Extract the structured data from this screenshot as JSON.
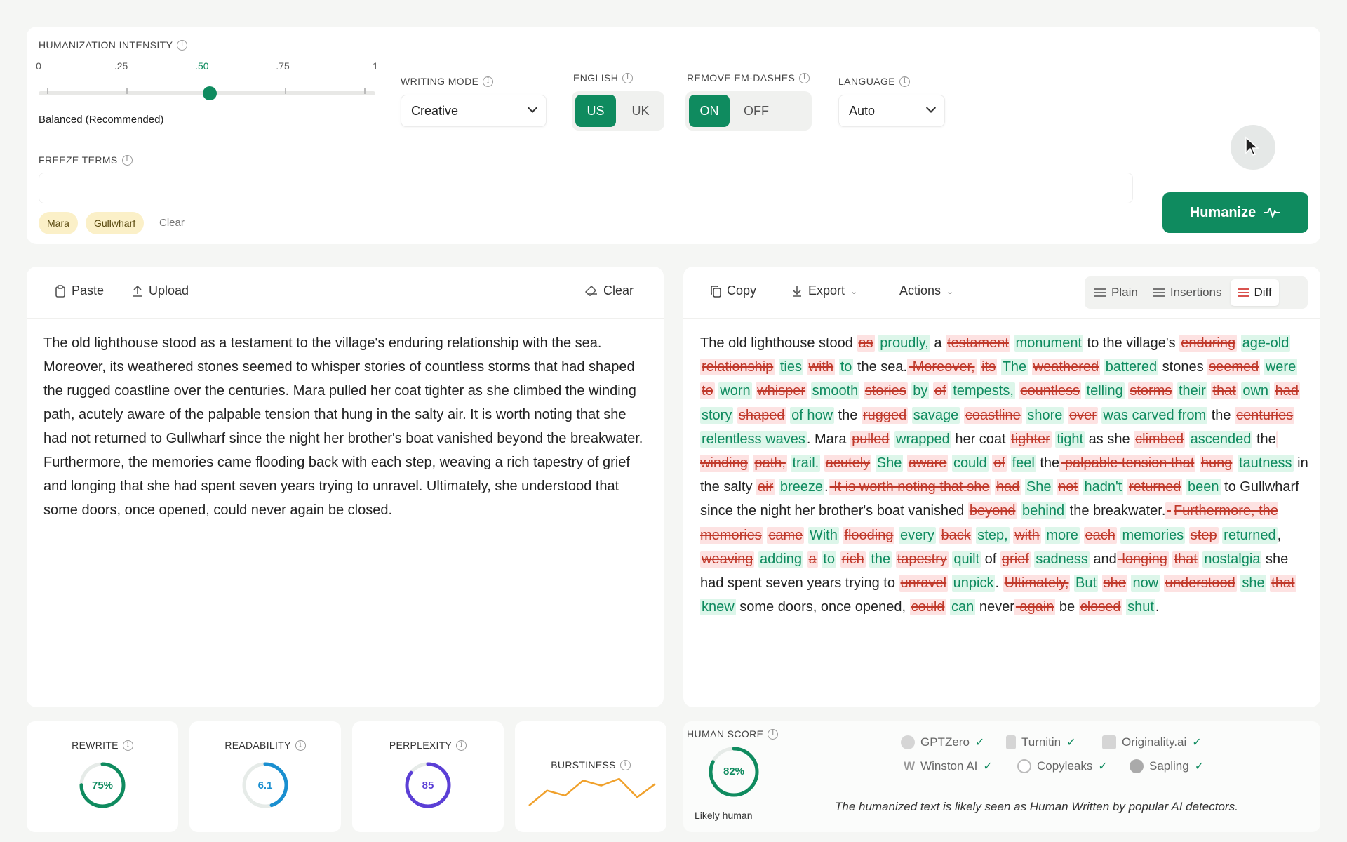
{
  "settings": {
    "intensity": {
      "label": "HUMANIZATION INTENSITY",
      "ticks": [
        "0",
        ".25",
        ".50",
        ".75",
        "1"
      ],
      "value": 0.5,
      "caption": "Balanced (Recommended)"
    },
    "writing_mode": {
      "label": "WRITING MODE",
      "value": "Creative"
    },
    "english": {
      "label": "ENGLISH",
      "options": [
        "US",
        "UK"
      ],
      "selected": "US"
    },
    "em_dashes": {
      "label": "REMOVE EM-DASHES",
      "options": [
        "ON",
        "OFF"
      ],
      "selected": "ON"
    },
    "language": {
      "label": "LANGUAGE",
      "value": "Auto"
    },
    "freeze": {
      "label": "FREEZE TERMS",
      "terms": [
        "Mara",
        "Gullwharf"
      ],
      "clear_label": "Clear"
    },
    "humanize_label": "Humanize"
  },
  "input": {
    "paste_label": "Paste",
    "upload_label": "Upload",
    "clear_label": "Clear",
    "text": "The old lighthouse stood as a testament to the village's enduring relationship with the sea. Moreover, its weathered stones seemed to whisper stories of countless storms that had shaped the rugged coastline over the centuries. Mara pulled her coat tighter as she climbed the winding path, acutely aware of the palpable tension that hung in the salty air. It is worth noting that she had not returned to Gullwharf since the night her brother's boat vanished beyond the breakwater. Furthermore, the memories came flooding back with each step, weaving a rich tapestry of grief and longing that she had spent seven years trying to unravel. Ultimately, she understood that some doors, once opened, could never again be closed."
  },
  "output": {
    "copy_label": "Copy",
    "export_label": "Export",
    "actions_label": "Actions",
    "views": [
      "Plain",
      "Insertions",
      "Diff"
    ],
    "selected_view": "Diff",
    "diff": [
      [
        "s",
        "The old lighthouse stood "
      ],
      [
        "d",
        "as"
      ],
      [
        "s",
        " "
      ],
      [
        "i",
        "proudly,"
      ],
      [
        "s",
        " a "
      ],
      [
        "d",
        "testament"
      ],
      [
        "s",
        " "
      ],
      [
        "i",
        "monument"
      ],
      [
        "s",
        " to the village's "
      ],
      [
        "d",
        "enduring"
      ],
      [
        "s",
        " "
      ],
      [
        "i",
        "age-old"
      ],
      [
        "s",
        " "
      ],
      [
        "d",
        "relationship"
      ],
      [
        "s",
        " "
      ],
      [
        "i",
        "ties"
      ],
      [
        "s",
        " "
      ],
      [
        "d",
        "with"
      ],
      [
        "s",
        " "
      ],
      [
        "i",
        "to"
      ],
      [
        "s",
        " the sea."
      ],
      [
        "d",
        " Moreover,"
      ],
      [
        "s",
        " "
      ],
      [
        "d",
        "its"
      ],
      [
        "s",
        " "
      ],
      [
        "i",
        "The"
      ],
      [
        "s",
        " "
      ],
      [
        "d",
        "weathered"
      ],
      [
        "s",
        " "
      ],
      [
        "i",
        "battered"
      ],
      [
        "s",
        " stones "
      ],
      [
        "d",
        "seemed"
      ],
      [
        "s",
        " "
      ],
      [
        "i",
        "were"
      ],
      [
        "s",
        " "
      ],
      [
        "d",
        "to"
      ],
      [
        "s",
        " "
      ],
      [
        "i",
        "worn"
      ],
      [
        "s",
        " "
      ],
      [
        "d",
        "whisper"
      ],
      [
        "s",
        " "
      ],
      [
        "i",
        "smooth"
      ],
      [
        "s",
        " "
      ],
      [
        "d",
        "stories"
      ],
      [
        "s",
        " "
      ],
      [
        "i",
        "by"
      ],
      [
        "s",
        " "
      ],
      [
        "d",
        "of"
      ],
      [
        "s",
        " "
      ],
      [
        "i",
        "tempests,"
      ],
      [
        "s",
        " "
      ],
      [
        "d",
        "countless"
      ],
      [
        "s",
        " "
      ],
      [
        "i",
        "telling"
      ],
      [
        "s",
        " "
      ],
      [
        "d",
        "storms"
      ],
      [
        "s",
        " "
      ],
      [
        "i",
        "their"
      ],
      [
        "s",
        " "
      ],
      [
        "d",
        "that"
      ],
      [
        "s",
        " "
      ],
      [
        "i",
        "own"
      ],
      [
        "s",
        " "
      ],
      [
        "d",
        "had"
      ],
      [
        "s",
        " "
      ],
      [
        "i",
        "story"
      ],
      [
        "s",
        " "
      ],
      [
        "d",
        "shaped"
      ],
      [
        "s",
        " "
      ],
      [
        "i",
        "of how"
      ],
      [
        "s",
        " the "
      ],
      [
        "d",
        "rugged"
      ],
      [
        "s",
        " "
      ],
      [
        "i",
        "savage"
      ],
      [
        "s",
        " "
      ],
      [
        "d",
        "coastline"
      ],
      [
        "s",
        " "
      ],
      [
        "i",
        "shore"
      ],
      [
        "s",
        " "
      ],
      [
        "d",
        "over"
      ],
      [
        "s",
        " "
      ],
      [
        "i",
        "was carved from"
      ],
      [
        "s",
        " the "
      ],
      [
        "d",
        "centuries"
      ],
      [
        "s",
        " "
      ],
      [
        "i",
        "relentless waves"
      ],
      [
        "s",
        ". "
      ],
      [
        "s",
        "Mara "
      ],
      [
        "d",
        "pulled"
      ],
      [
        "s",
        " "
      ],
      [
        "i",
        "wrapped"
      ],
      [
        "s",
        " her coat "
      ],
      [
        "d",
        "tighter"
      ],
      [
        "s",
        " "
      ],
      [
        "i",
        "tight"
      ],
      [
        "s",
        " as she "
      ],
      [
        "d",
        "climbed"
      ],
      [
        "s",
        " "
      ],
      [
        "i",
        "ascended"
      ],
      [
        "s",
        " the"
      ],
      [
        "d",
        " winding"
      ],
      [
        "s",
        " "
      ],
      [
        "d",
        "path,"
      ],
      [
        "s",
        " "
      ],
      [
        "i",
        "trail."
      ],
      [
        "s",
        " "
      ],
      [
        "d",
        "acutely"
      ],
      [
        "s",
        " "
      ],
      [
        "i",
        "She"
      ],
      [
        "s",
        " "
      ],
      [
        "d",
        "aware"
      ],
      [
        "s",
        " "
      ],
      [
        "i",
        "could"
      ],
      [
        "s",
        " "
      ],
      [
        "d",
        "of"
      ],
      [
        "s",
        " "
      ],
      [
        "i",
        "feel"
      ],
      [
        "s",
        " the"
      ],
      [
        "d",
        " palpable tension that"
      ],
      [
        "s",
        " "
      ],
      [
        "d",
        "hung"
      ],
      [
        "s",
        " "
      ],
      [
        "i",
        "tautness"
      ],
      [
        "s",
        " in "
      ],
      [
        "s",
        "the salty "
      ],
      [
        "d",
        "air"
      ],
      [
        "s",
        " "
      ],
      [
        "i",
        "breeze"
      ],
      [
        "s",
        "."
      ],
      [
        "d",
        " It is worth noting that she"
      ],
      [
        "s",
        " "
      ],
      [
        "d",
        "had"
      ],
      [
        "s",
        " "
      ],
      [
        "i",
        "She"
      ],
      [
        "s",
        " "
      ],
      [
        "d",
        "not"
      ],
      [
        "s",
        " "
      ],
      [
        "i",
        "hadn't"
      ],
      [
        "s",
        " "
      ],
      [
        "d",
        "returned"
      ],
      [
        "s",
        " "
      ],
      [
        "i",
        "been"
      ],
      [
        "s",
        " to "
      ],
      [
        "s",
        "Gullwharf since the night her brother's boat vanished "
      ],
      [
        "d",
        "beyond"
      ],
      [
        "s",
        " "
      ],
      [
        "i",
        "behind"
      ],
      [
        "s",
        " the breakwater."
      ],
      [
        "d",
        " "
      ],
      [
        "s",
        " "
      ],
      [
        "d",
        "Furthermore, the memories"
      ],
      [
        "s",
        " "
      ],
      [
        "d",
        "came"
      ],
      [
        "s",
        " "
      ],
      [
        "i",
        "With"
      ],
      [
        "s",
        " "
      ],
      [
        "d",
        "flooding"
      ],
      [
        "s",
        " "
      ],
      [
        "i",
        "every"
      ],
      [
        "s",
        " "
      ],
      [
        "d",
        "back"
      ],
      [
        "s",
        " "
      ],
      [
        "i",
        "step,"
      ],
      [
        "s",
        " "
      ],
      [
        "d",
        "with"
      ],
      [
        "s",
        " "
      ],
      [
        "i",
        "more"
      ],
      [
        "s",
        " "
      ],
      [
        "d",
        "each"
      ],
      [
        "s",
        " "
      ],
      [
        "i",
        "memories"
      ],
      [
        "s",
        " "
      ],
      [
        "d",
        "step"
      ],
      [
        "s",
        " "
      ],
      [
        "i",
        "returned"
      ],
      [
        "s",
        ", "
      ],
      [
        "d",
        "weaving"
      ],
      [
        "s",
        " "
      ],
      [
        "i",
        "adding"
      ],
      [
        "s",
        " "
      ],
      [
        "d",
        "a"
      ],
      [
        "s",
        " "
      ],
      [
        "i",
        "to"
      ],
      [
        "s",
        " "
      ],
      [
        "d",
        "rich"
      ],
      [
        "s",
        " "
      ],
      [
        "i",
        "the"
      ],
      [
        "s",
        " "
      ],
      [
        "d",
        "tapestry"
      ],
      [
        "s",
        " "
      ],
      [
        "i",
        "quilt"
      ],
      [
        "s",
        " of "
      ],
      [
        "d",
        "grief"
      ],
      [
        "s",
        " "
      ],
      [
        "i",
        "sadness"
      ],
      [
        "s",
        " and"
      ],
      [
        "d",
        " longing"
      ],
      [
        "s",
        " "
      ],
      [
        "d",
        "that"
      ],
      [
        "s",
        " "
      ],
      [
        "i",
        "nostalgia"
      ],
      [
        "s",
        " she had spent seven years trying to "
      ],
      [
        "d",
        "unravel"
      ],
      [
        "s",
        " "
      ],
      [
        "i",
        "unpick"
      ],
      [
        "s",
        ". "
      ],
      [
        "d",
        "Ultimately,"
      ],
      [
        "s",
        " "
      ],
      [
        "i",
        "But"
      ],
      [
        "s",
        " "
      ],
      [
        "d",
        "she"
      ],
      [
        "s",
        " "
      ],
      [
        "i",
        "now"
      ],
      [
        "s",
        " "
      ],
      [
        "d",
        "understood"
      ],
      [
        "s",
        " "
      ],
      [
        "i",
        "she"
      ],
      [
        "s",
        " "
      ],
      [
        "d",
        "that"
      ],
      [
        "s",
        " "
      ],
      [
        "i",
        "knew"
      ],
      [
        "s",
        " some doors, once "
      ],
      [
        "s",
        "opened, "
      ],
      [
        "d",
        "could"
      ],
      [
        "s",
        " "
      ],
      [
        "i",
        "can"
      ],
      [
        "s",
        " never"
      ],
      [
        "d",
        " again"
      ],
      [
        "s",
        " be "
      ],
      [
        "d",
        "closed"
      ],
      [
        "s",
        " "
      ],
      [
        "i",
        "shut"
      ],
      [
        "s",
        "."
      ]
    ]
  },
  "metrics": {
    "rewrite": {
      "label": "REWRITE",
      "value": "75%",
      "fraction": 0.75,
      "color": "#0f8b5f"
    },
    "readability": {
      "label": "READABILITY",
      "value": "6.1",
      "fraction": 0.45,
      "color": "#1a8fd0"
    },
    "perplexity": {
      "label": "PERPLEXITY",
      "value": "85",
      "fraction": 0.85,
      "color": "#5b3fd6"
    },
    "burstiness": {
      "label": "BURSTINESS",
      "series": [
        10,
        28,
        22,
        40,
        34,
        42,
        20,
        36
      ],
      "color": "#f0a12c"
    }
  },
  "human_score": {
    "label": "HUMAN SCORE",
    "value": "82%",
    "fraction": 0.82,
    "caption": "Likely human",
    "detectors": [
      "GPTZero",
      "Turnitin",
      "Originality.ai",
      "Winston AI",
      "Copyleaks",
      "Sapling"
    ],
    "verdict": "The humanized text is likely seen as Human Written by popular AI detectors."
  }
}
